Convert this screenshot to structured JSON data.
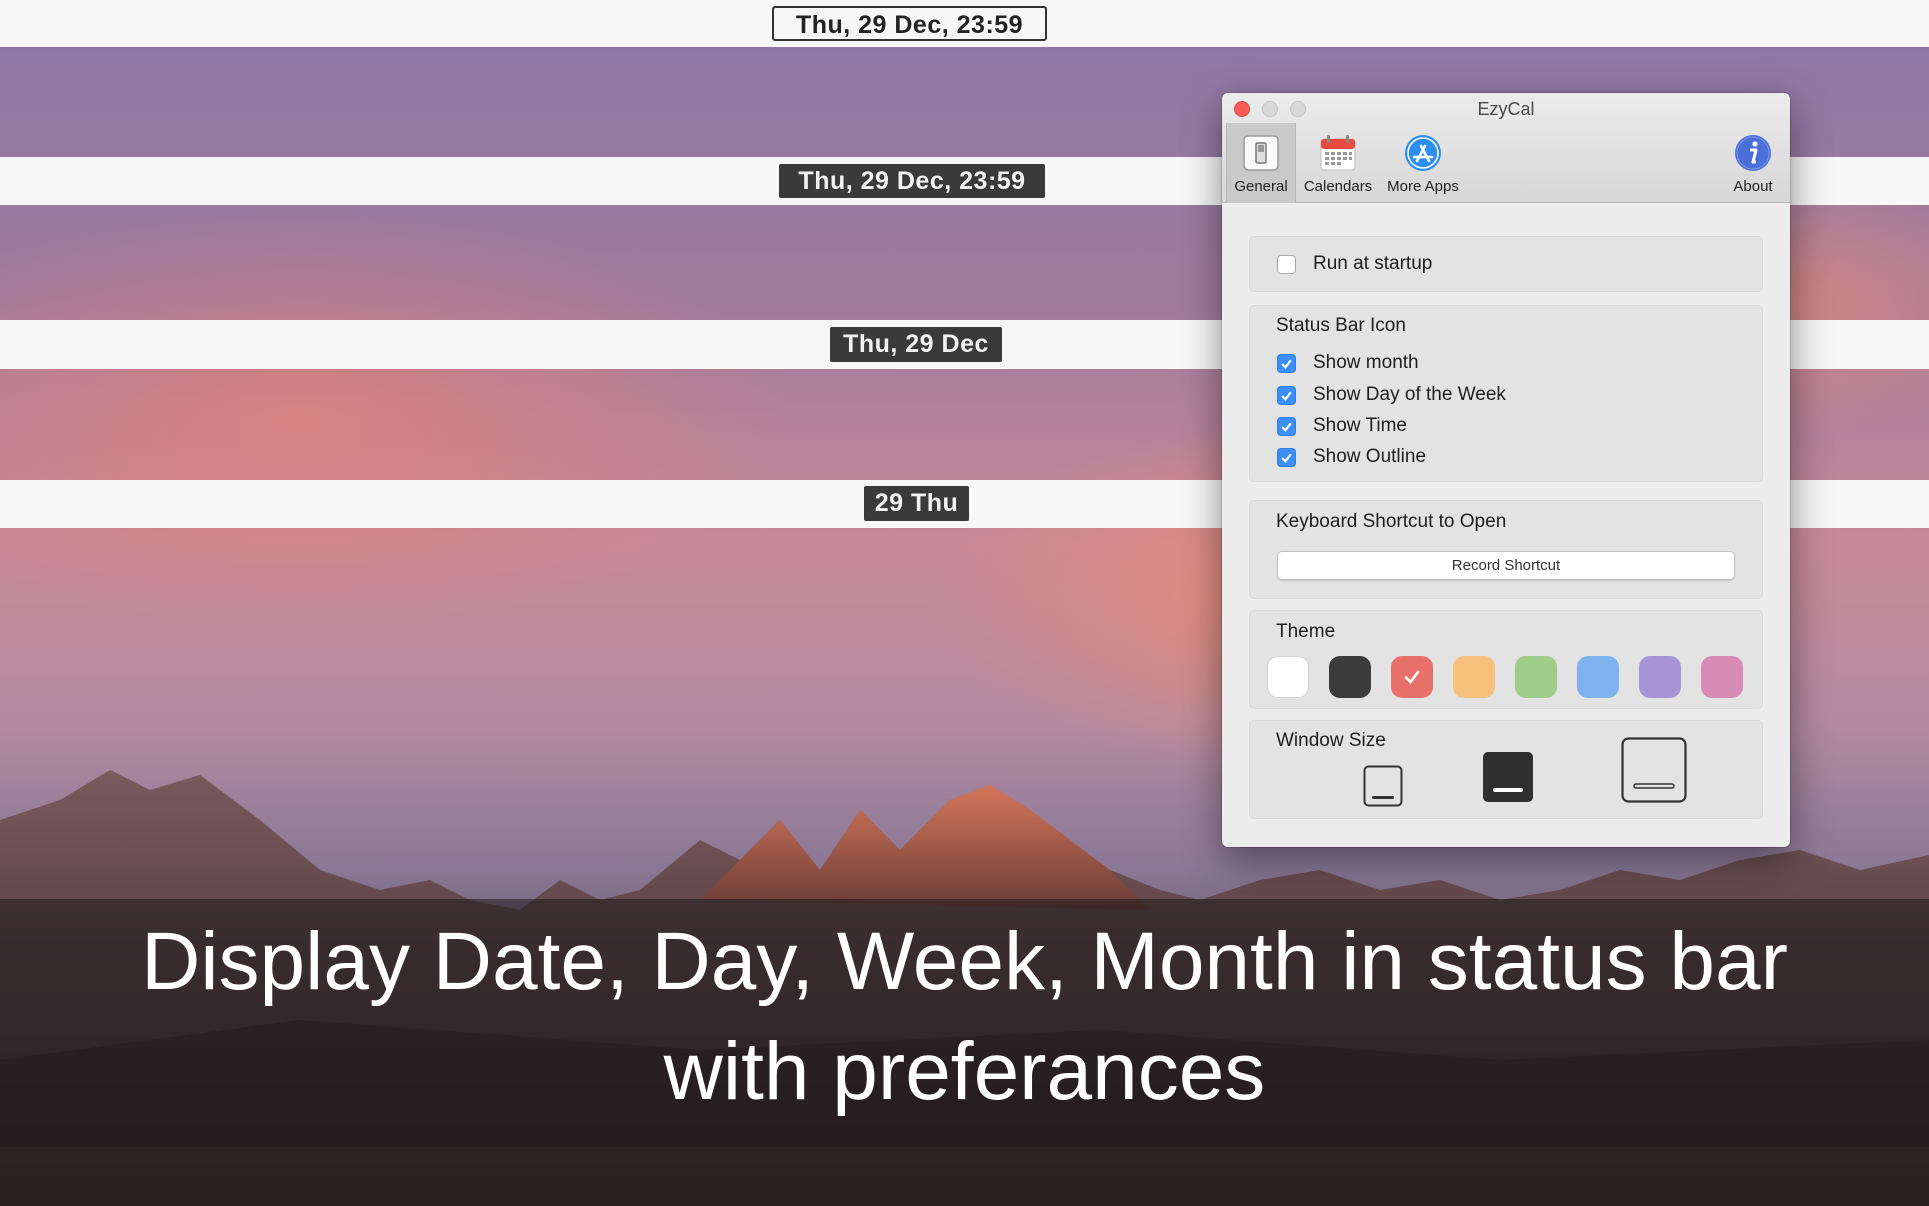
{
  "status_bars": [
    {
      "clock": "Thu, 29 Dec, 23:59",
      "style": "outline"
    },
    {
      "clock": "Thu, 29 Dec, 23:59",
      "style": "dark"
    },
    {
      "clock": "Thu, 29 Dec",
      "style": "dark"
    },
    {
      "clock": "29 Thu",
      "style": "dark"
    }
  ],
  "window": {
    "title": "EzyCal",
    "toolbar": [
      {
        "label": "General",
        "icon": "general-switch-icon",
        "selected": true
      },
      {
        "label": "Calendars",
        "icon": "calendar-icon",
        "selected": false
      },
      {
        "label": "More Apps",
        "icon": "app-store-icon",
        "selected": false
      },
      {
        "label": "About",
        "icon": "info-icon",
        "selected": false
      }
    ],
    "run_at_startup": {
      "label": "Run at startup",
      "checked": false
    },
    "status_bar_icon": {
      "title": "Status Bar Icon",
      "options": [
        {
          "label": "Show month",
          "checked": true
        },
        {
          "label": "Show Day of the Week",
          "checked": true
        },
        {
          "label": "Show Time",
          "checked": true
        },
        {
          "label": "Show Outline",
          "checked": true
        }
      ]
    },
    "shortcut": {
      "title": "Keyboard Shortcut to Open",
      "button_label": "Record Shortcut"
    },
    "theme": {
      "title": "Theme",
      "swatches": [
        {
          "color": "#ffffff",
          "selected": false
        },
        {
          "color": "#3c3c3c",
          "selected": false
        },
        {
          "color": "#e8706a",
          "selected": true
        },
        {
          "color": "#f5c17c",
          "selected": false
        },
        {
          "color": "#9fcd88",
          "selected": false
        },
        {
          "color": "#7fb3ef",
          "selected": false
        },
        {
          "color": "#a694d6",
          "selected": false
        },
        {
          "color": "#d88cb4",
          "selected": false
        }
      ]
    },
    "window_size": {
      "title": "Window Size",
      "options": [
        "small",
        "medium",
        "large"
      ],
      "selected": "medium"
    }
  },
  "caption": {
    "line1": "Display Date, Day, Week, Month in status bar",
    "line2": "with preferances"
  }
}
